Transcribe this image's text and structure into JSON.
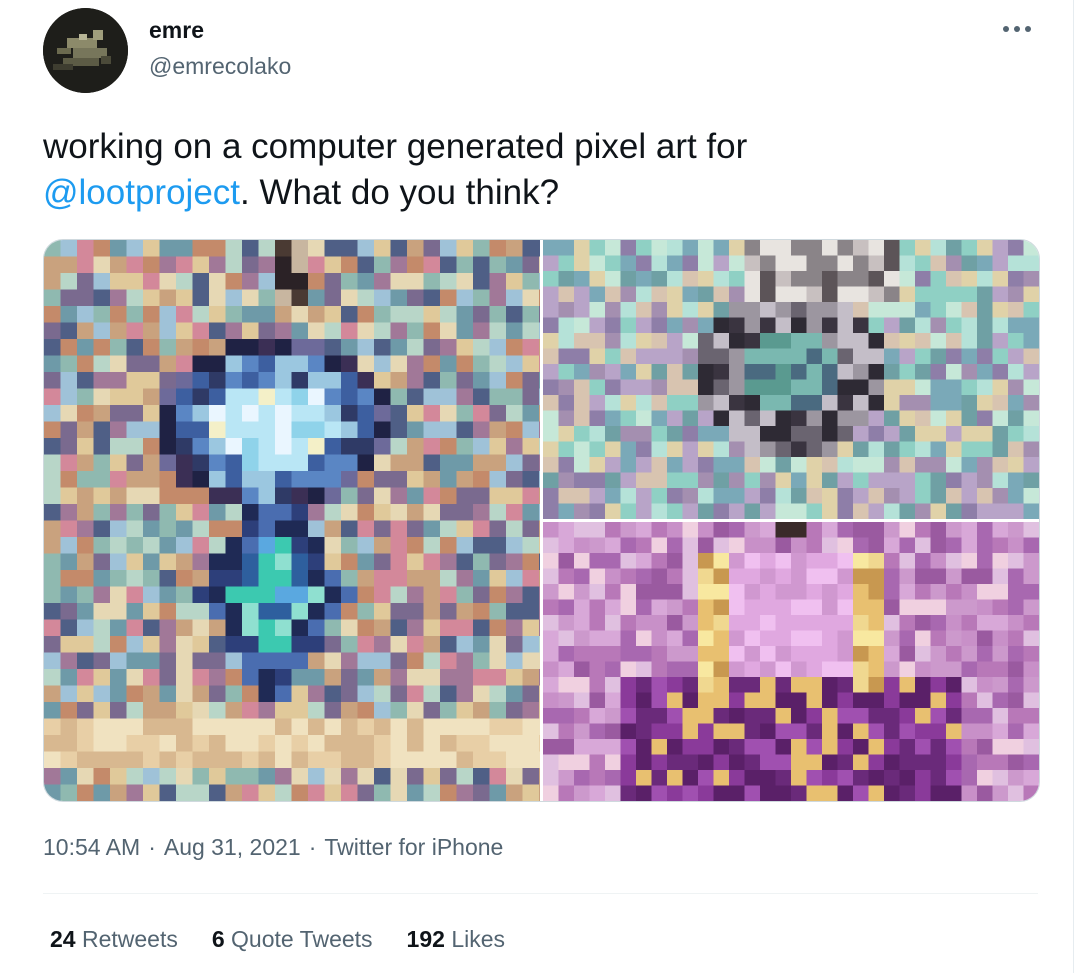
{
  "author": {
    "name": "emre",
    "handle": "@emrecolako"
  },
  "tweet": {
    "text_before": "working on a computer generated pixel art for",
    "mention": "@lootproject",
    "text_after": ". What do you think?"
  },
  "media": [
    {
      "subject": "pendant"
    },
    {
      "subject": "ring"
    },
    {
      "subject": "robe"
    }
  ],
  "meta": {
    "time": "10:54 AM",
    "separator": "·",
    "date": "Aug 31, 2021",
    "source": "Twitter for iPhone"
  },
  "stats": {
    "retweets": {
      "count": "24",
      "label": "Retweets"
    },
    "quotes": {
      "count": "6",
      "label": "Quote Tweets"
    },
    "likes": {
      "count": "192",
      "label": "Likes"
    }
  },
  "icons": {
    "more": "more-horizontal-icon"
  },
  "colors": {
    "link": "#1d9bf0",
    "secondary_text": "#536471",
    "primary_text": "#0f1419"
  }
}
